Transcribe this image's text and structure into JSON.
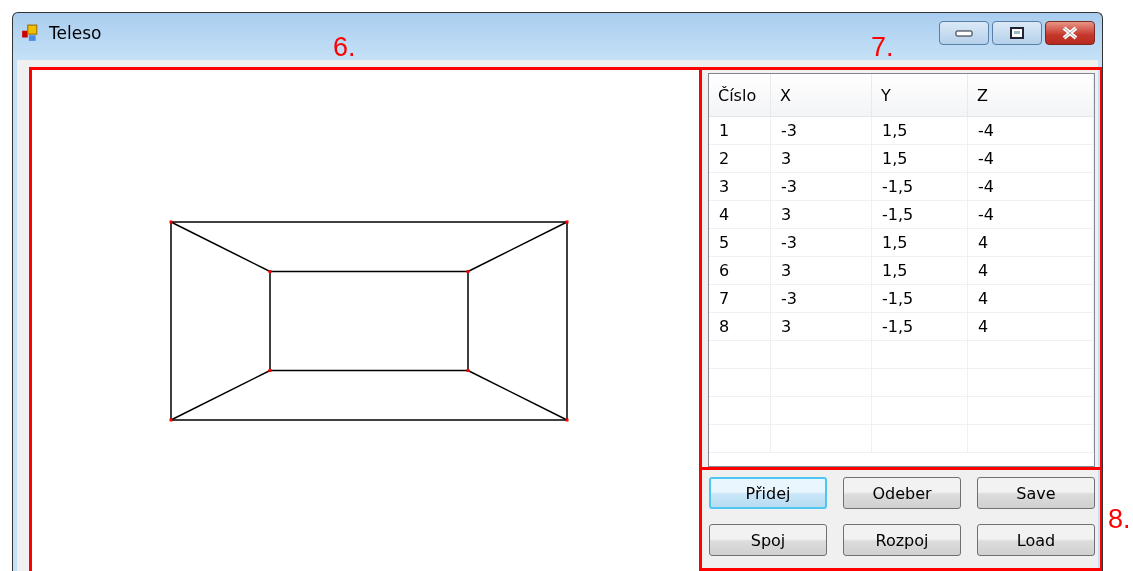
{
  "window": {
    "title": "Teleso"
  },
  "annotations": [
    {
      "label": "6."
    },
    {
      "label": "7."
    },
    {
      "label": "8."
    }
  ],
  "table": {
    "columns": [
      "Číslo",
      "X",
      "Y",
      "Z"
    ],
    "rows": [
      {
        "cells": [
          "1",
          "-3",
          "1,5",
          "-4"
        ]
      },
      {
        "cells": [
          "2",
          "3",
          "1,5",
          "-4"
        ]
      },
      {
        "cells": [
          "3",
          "-3",
          "-1,5",
          "-4"
        ]
      },
      {
        "cells": [
          "4",
          "3",
          "-1,5",
          "-4"
        ]
      },
      {
        "cells": [
          "5",
          "-3",
          "1,5",
          "4"
        ]
      },
      {
        "cells": [
          "6",
          "3",
          "1,5",
          "4"
        ]
      },
      {
        "cells": [
          "7",
          "-3",
          "-1,5",
          "4"
        ]
      },
      {
        "cells": [
          "8",
          "3",
          "-1,5",
          "4"
        ]
      }
    ]
  },
  "buttons": [
    {
      "label": "Přidej",
      "focused": true
    },
    {
      "label": "Odeber",
      "focused": false
    },
    {
      "label": "Save",
      "focused": false
    },
    {
      "label": "Spoj",
      "focused": false
    },
    {
      "label": "Rozpoj",
      "focused": false
    },
    {
      "label": "Load",
      "focused": false
    }
  ]
}
